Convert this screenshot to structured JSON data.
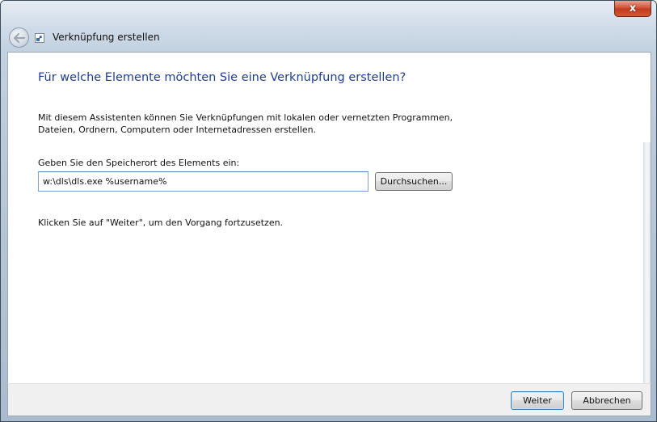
{
  "window": {
    "title": "Verknüpfung erstellen",
    "close_glyph": "x"
  },
  "icons": {
    "back": "back-arrow-icon",
    "title": "shortcut-icon",
    "close": "close-icon"
  },
  "main": {
    "heading": "Für welche Elemente möchten Sie eine Verknüpfung erstellen?",
    "intro": "Mit diesem Assistenten können Sie Verknüpfungen mit lokalen oder vernetzten Programmen, Dateien, Ordnern, Computern oder Internetadressen erstellen.",
    "location_label": "Geben Sie den Speicherort des Elements ein:",
    "location_value": "w:\\dls\\dls.exe %username%",
    "browse_label": "Durchsuchen...",
    "continue_hint": "Klicken Sie auf \"Weiter\", um den Vorgang fortzusetzen."
  },
  "footer": {
    "next_label": "Weiter",
    "cancel_label": "Abbrechen"
  },
  "colors": {
    "heading": "#1f3f8e",
    "input_border": "#7da2ce",
    "close_button": "#c23a1e"
  }
}
